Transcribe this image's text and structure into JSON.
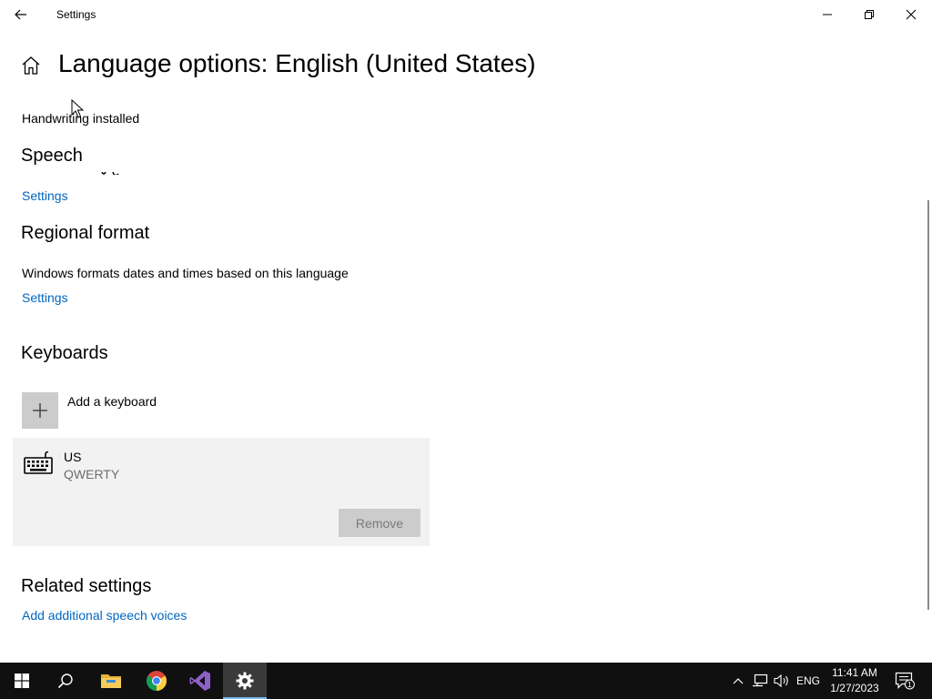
{
  "window": {
    "title": "Settings",
    "minimize_icon": "minimize-icon",
    "maximize_icon": "restore-icon",
    "close_icon": "close-icon"
  },
  "header": {
    "page_title": "Language options: English (United States)",
    "home_icon": "home-icon",
    "back_icon": "back-arrow-icon"
  },
  "handwriting": {
    "status": "Handwriting installed"
  },
  "speech": {
    "heading": "Speech",
    "settings_link": "Settings"
  },
  "regional_format": {
    "heading": "Regional format",
    "description": "Windows formats dates and times based on this language",
    "settings_link": "Settings"
  },
  "keyboards": {
    "heading": "Keyboards",
    "add_label": "Add a keyboard",
    "items": [
      {
        "name": "US",
        "layout": "QWERTY",
        "remove_label": "Remove"
      }
    ]
  },
  "related_settings": {
    "heading": "Related settings",
    "links": [
      "Add additional speech voices"
    ]
  },
  "taskbar": {
    "apps": [
      "start-icon",
      "search-icon",
      "file-explorer-icon",
      "chrome-icon",
      "visual-studio-icon",
      "settings-gear-icon"
    ],
    "tray": {
      "language": "ENG",
      "time": "11:41 AM",
      "date": "1/27/2023",
      "notification_count": "1"
    }
  },
  "colors": {
    "accent_link": "#0067c0",
    "taskbar_bg": "#101010",
    "card_bg": "#f2f2f2",
    "button_disabled_bg": "#cccccc"
  }
}
